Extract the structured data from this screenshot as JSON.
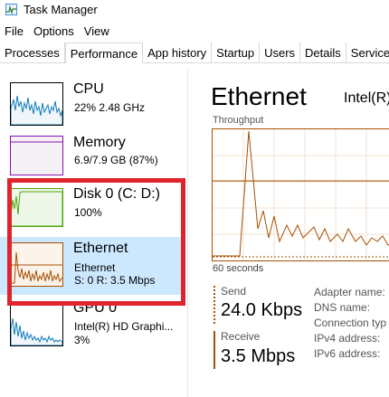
{
  "window": {
    "title": "Task Manager",
    "icon": "task-manager-icon"
  },
  "menu": [
    "File",
    "Options",
    "View"
  ],
  "tabs": [
    "Processes",
    "Performance",
    "App history",
    "Startup",
    "Users",
    "Details",
    "Services"
  ],
  "active_tab": "Performance",
  "sidebar": {
    "items": [
      {
        "name": "CPU",
        "line1": "22% 2.48 GHz",
        "color": "#117dbb",
        "fill": "#f1f6fa",
        "selected": false
      },
      {
        "name": "Memory",
        "line1": "6.9/7.9 GB (87%)",
        "color": "#8b12ae",
        "fill": "#f4f2f4",
        "selected": false
      },
      {
        "name": "Disk 0 (C: D:)",
        "line1": "100%",
        "color": "#4da60c",
        "fill": "#eff7e8",
        "selected": false
      },
      {
        "name": "Ethernet",
        "line1": "Ethernet",
        "line2": "S: 0 R: 3.5 Mbps",
        "color": "#a74f01",
        "fill": "#fcf3eb",
        "selected": true
      },
      {
        "name": "GPU 0",
        "line1": "Intel(R) HD Graphi...",
        "line2": "3%",
        "color": "#117dbb",
        "fill": "#f1f6fa",
        "selected": false
      }
    ]
  },
  "detail": {
    "title": "Ethernet",
    "adapter": "Intel(R)",
    "graph_label": "Throughput",
    "time_label": "60 seconds",
    "send_label": "Send",
    "send_value": "24.0 Kbps",
    "receive_label": "Receive",
    "receive_value": "3.5 Mbps",
    "properties": [
      "Adapter name:",
      "DNS name:",
      "Connection typ",
      "IPv4 address:",
      "IPv6 address:"
    ]
  },
  "colors": {
    "accent": "#a74f01",
    "highlight": "#e0242d",
    "selected_bg": "#cce8ff"
  }
}
